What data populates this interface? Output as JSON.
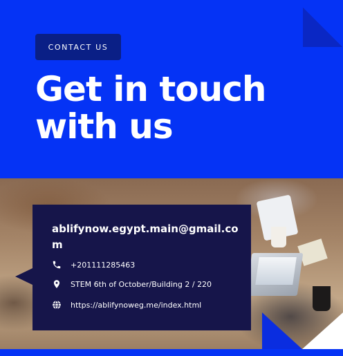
{
  "header": {
    "badge": "CONTACT US",
    "title_line1": "Get in touch",
    "title_line2": "with us"
  },
  "contact": {
    "email": "ablifynow.egypt.main@gmail.com",
    "phone": "+201111285463",
    "address": "STEM 6th of October/Building 2 / 220",
    "website": "https://ablifynoweg.me/index.html"
  },
  "icons": {
    "phone": "phone-icon",
    "address": "location-pin-icon",
    "website": "globe-icon"
  },
  "colors": {
    "background_blue": "#0533f5",
    "pill": "#0a1f86",
    "card": "#16154a",
    "text": "#ffffff"
  }
}
